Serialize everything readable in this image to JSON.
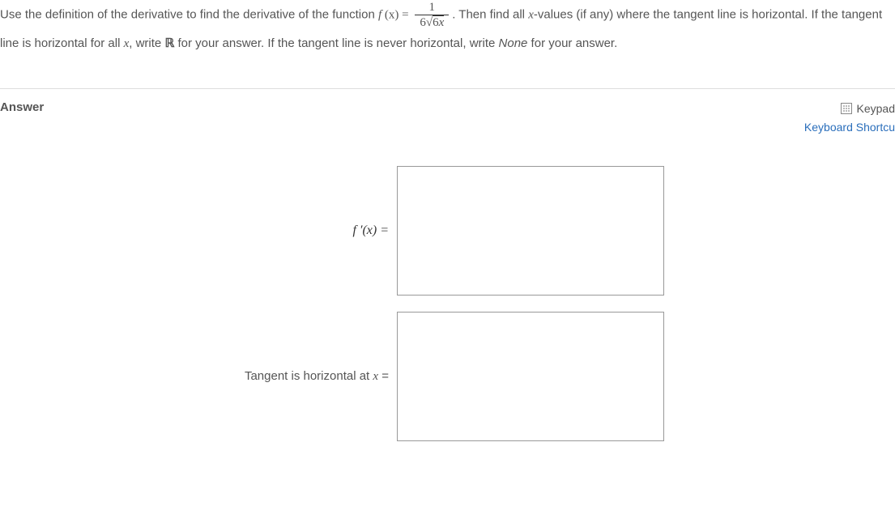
{
  "question": {
    "part1": "Use the definition of the derivative to find the derivative of the function ",
    "fx": "f ",
    "fx_paren": "(x) = ",
    "frac_num": "1",
    "frac_den_coef": "6",
    "frac_den_radicand": "6",
    "frac_den_var": "x",
    "part2": ". Then find all ",
    "xvar": "x",
    "part3": "-values (if any) where the tangent line is horizontal. If the tangent line is horizontal for all ",
    "xvar2": "x",
    "part4": ", write ",
    "real": "ℝ",
    "part5": " for your answer. If the tangent line is never horizontal, write ",
    "none_word": "None",
    "part6": " for your answer."
  },
  "labels": {
    "answer": "Answer",
    "keypad": "Keypad",
    "shortcut": "Keyboard Shortcu",
    "fprime": "f ′(x) =",
    "tangent_label_text": "Tangent is horizontal at ",
    "tangent_x": "x",
    "tangent_eq": " ="
  }
}
